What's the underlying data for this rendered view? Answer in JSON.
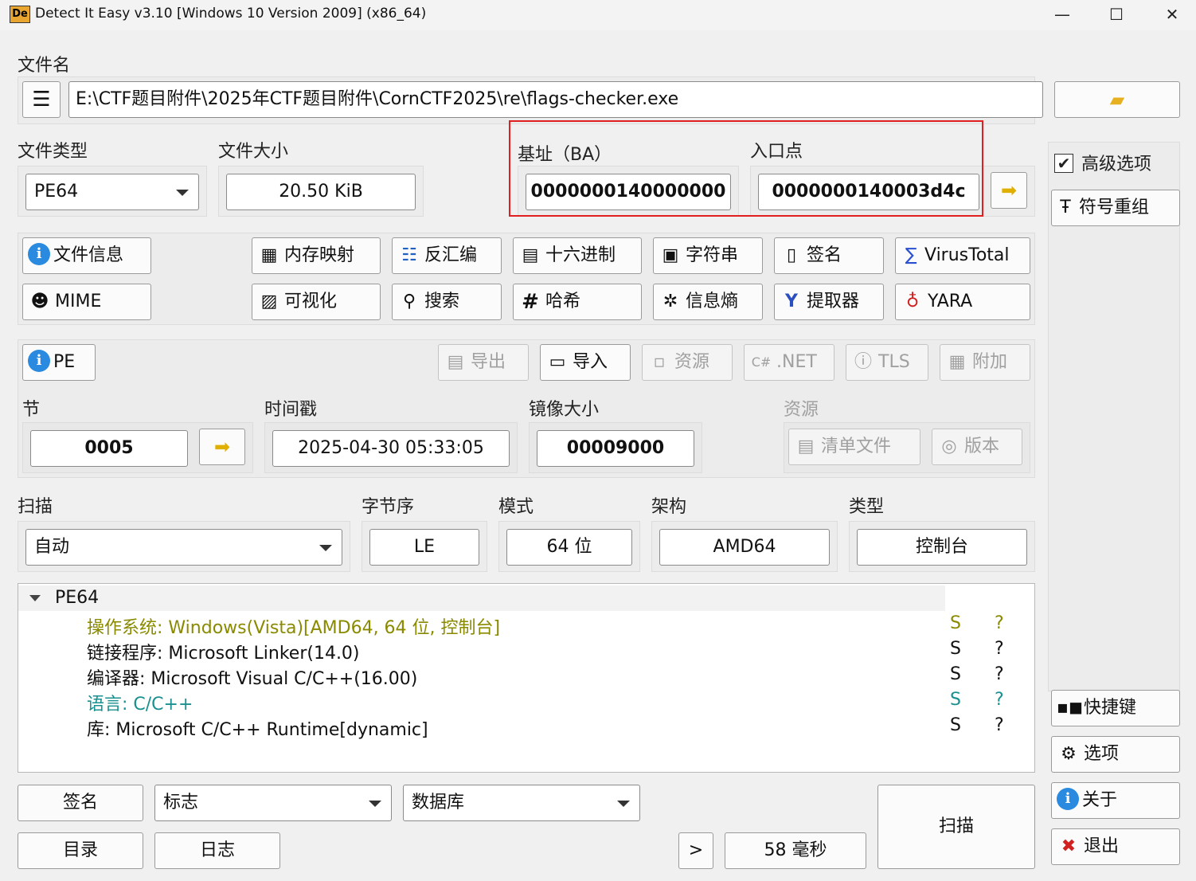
{
  "window": {
    "title": "Detect It Easy v3.10 [Windows 10 Version 2009] (x86_64)",
    "icon_text": "De",
    "minimize": "—",
    "maximize": "☐",
    "close": "✕"
  },
  "file": {
    "label": "文件名",
    "path": "E:\\CTF题目附件\\2025年CTF题目附件\\CornCTF2025\\re\\flags-checker.exe"
  },
  "info": {
    "file_type_label": "文件类型",
    "file_type_value": "PE64",
    "file_size_label": "文件大小",
    "file_size_value": "20.50 KiB",
    "base_label": "基址（BA）",
    "base_value": "0000000140000000",
    "entry_label": "入口点",
    "entry_value": "0000000140003d4c"
  },
  "options": {
    "advanced_label": "高级选项",
    "advanced_checked": true,
    "demangle_label": "符号重组"
  },
  "tools": {
    "file_info": "文件信息",
    "memory_map": "内存映射",
    "disasm": "反汇编",
    "hex": "十六进制",
    "strings": "字符串",
    "signature": "签名",
    "virustotal": "VirusTotal",
    "mime": "MIME",
    "visualize": "可视化",
    "search": "搜索",
    "hash": "哈希",
    "entropy": "信息熵",
    "extractor": "提取器",
    "yara": "YARA"
  },
  "pe": {
    "pe_button": "PE",
    "export": "导出",
    "import": "导入",
    "resources": "资源",
    "dotnet": ".NET",
    "tls": "TLS",
    "overlay": "附加",
    "sections_label": "节",
    "sections_value": "0005",
    "timestamp_label": "时间戳",
    "timestamp_value": "2025-04-30 05:33:05",
    "image_size_label": "镜像大小",
    "image_size_value": "00009000",
    "res_label": "资源",
    "manifest": "清单文件",
    "version": "版本"
  },
  "scan": {
    "scan_label": "扫描",
    "scan_mode": "自动",
    "endian_label": "字节序",
    "endian_value": "LE",
    "mode_label": "模式",
    "mode_value": "64 位",
    "arch_label": "架构",
    "arch_value": "AMD64",
    "type_label": "类型",
    "type_value": "控制台"
  },
  "results": {
    "root": "PE64",
    "rows": [
      {
        "text": "操作系统: Windows(Vista)[AMD64, 64 位, 控制台]",
        "s": "S",
        "q": "?"
      },
      {
        "text": "链接程序: Microsoft Linker(14.0)",
        "s": "S",
        "q": "?"
      },
      {
        "text": "编译器: Microsoft Visual C/C++(16.00)",
        "s": "S",
        "q": "?"
      },
      {
        "text": "语言: C/C++",
        "s": "S",
        "q": "?"
      },
      {
        "text": "库: Microsoft C/C++ Runtime[dynamic]",
        "s": "S",
        "q": "?"
      }
    ]
  },
  "bottom": {
    "signatures": "签名",
    "flags": "标志",
    "database": "数据库",
    "directory": "目录",
    "log": "日志",
    "more": ">",
    "time": "58 毫秒",
    "scan": "扫描"
  },
  "side": {
    "shortcuts": "快捷键",
    "settings": "选项",
    "about": "关于",
    "exit": "退出"
  }
}
